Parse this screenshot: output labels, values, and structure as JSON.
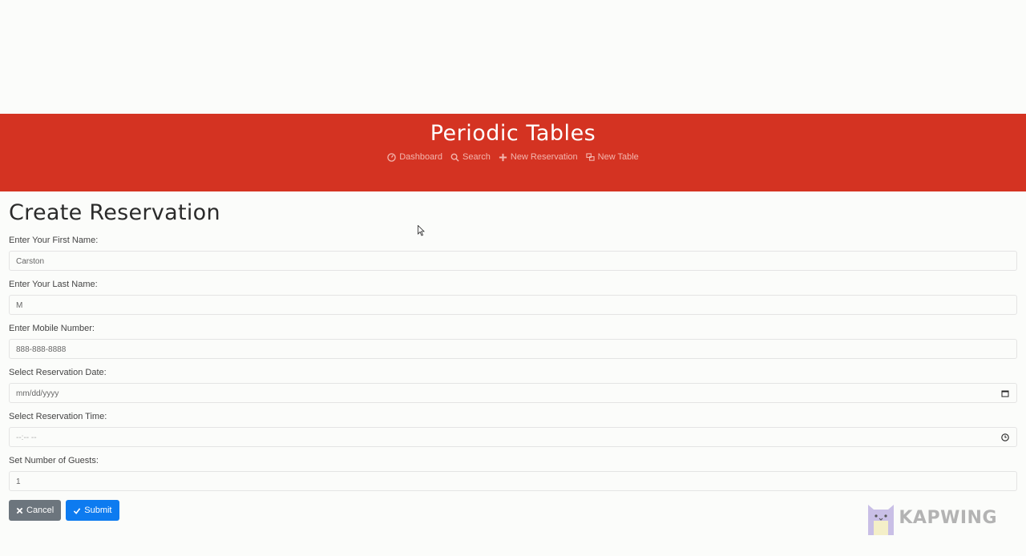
{
  "banner": {
    "title": "Periodic Tables",
    "nav": [
      {
        "label": "Dashboard",
        "icon": "dashboard-icon"
      },
      {
        "label": "Search",
        "icon": "search-icon"
      },
      {
        "label": "New Reservation",
        "icon": "plus-icon"
      },
      {
        "label": "New Table",
        "icon": "table-icon"
      }
    ]
  },
  "page": {
    "title": "Create Reservation"
  },
  "form": {
    "first_name": {
      "label": "Enter Your First Name:",
      "value": "Carston"
    },
    "last_name": {
      "label": "Enter Your Last Name:",
      "value": "M"
    },
    "mobile": {
      "label": "Enter Mobile Number:",
      "value": "888-888-8888"
    },
    "date": {
      "label": "Select Reservation Date:",
      "placeholder": "mm/dd/yyyy",
      "icon": "calendar-icon"
    },
    "time": {
      "label": "Select Reservation Time:",
      "placeholder": "--:-- --",
      "icon": "clock-icon"
    },
    "guests": {
      "label": "Set Number of Guests:",
      "value": "1"
    }
  },
  "buttons": {
    "cancel": {
      "label": "Cancel",
      "icon": "x-icon"
    },
    "submit": {
      "label": "Submit",
      "icon": "check-icon"
    }
  },
  "watermark": {
    "text": "KAPWING"
  },
  "colors": {
    "banner": "#d43322",
    "submit": "#0d7bf0",
    "cancel": "#6c757d"
  }
}
